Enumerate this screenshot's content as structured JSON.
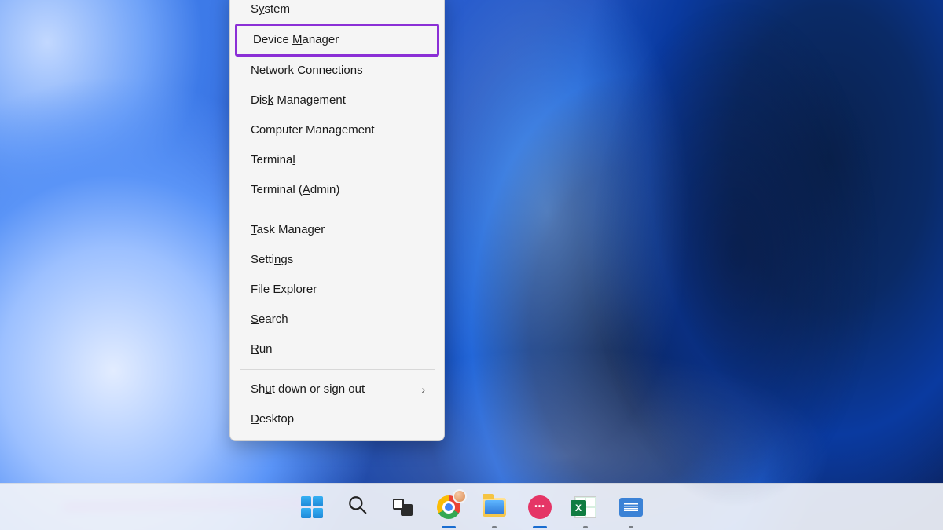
{
  "context_menu": {
    "groups": [
      {
        "items": [
          {
            "id": "system",
            "pre": "S",
            "u": "y",
            "post": "stem",
            "highlight": false
          },
          {
            "id": "device-manager",
            "pre": "Device ",
            "u": "M",
            "post": "anager",
            "highlight": true
          },
          {
            "id": "network-connections",
            "pre": "Net",
            "u": "w",
            "post": "ork Connections",
            "highlight": false
          },
          {
            "id": "disk-management",
            "pre": "Dis",
            "u": "k",
            "post": " Management",
            "highlight": false
          },
          {
            "id": "computer-management",
            "pre": "Computer Mana",
            "u": "g",
            "post": "ement",
            "highlight": false
          },
          {
            "id": "terminal",
            "pre": "Termina",
            "u": "l",
            "post": "",
            "highlight": false
          },
          {
            "id": "terminal-admin",
            "pre": "Terminal (",
            "u": "A",
            "post": "dmin)",
            "highlight": false
          }
        ]
      },
      {
        "items": [
          {
            "id": "task-manager",
            "pre": "",
            "u": "T",
            "post": "ask Manager",
            "highlight": false
          },
          {
            "id": "settings",
            "pre": "Setti",
            "u": "n",
            "post": "gs",
            "highlight": false
          },
          {
            "id": "file-explorer",
            "pre": "File ",
            "u": "E",
            "post": "xplorer",
            "highlight": false
          },
          {
            "id": "search",
            "pre": "",
            "u": "S",
            "post": "earch",
            "highlight": false
          },
          {
            "id": "run",
            "pre": "",
            "u": "R",
            "post": "un",
            "highlight": false
          }
        ]
      },
      {
        "items": [
          {
            "id": "shutdown-signout",
            "pre": "Sh",
            "u": "u",
            "post": "t down or sign out",
            "highlight": false,
            "submenu": true
          },
          {
            "id": "desktop",
            "pre": "",
            "u": "D",
            "post": "esktop",
            "highlight": false
          }
        ]
      }
    ]
  },
  "taskbar": {
    "start": {
      "name": "start-button"
    },
    "search": {
      "name": "search-icon"
    },
    "task_view": {
      "name": "task-view-icon"
    },
    "chrome": {
      "name": "google-chrome-icon"
    },
    "explorer": {
      "name": "file-explorer-icon"
    },
    "snagit": {
      "name": "snagit-icon",
      "glyph": "•••"
    },
    "excel": {
      "name": "excel-icon"
    },
    "wordpad": {
      "name": "wordpad-icon"
    }
  },
  "annotation": {
    "highlight_color": "#8b2fd6"
  }
}
